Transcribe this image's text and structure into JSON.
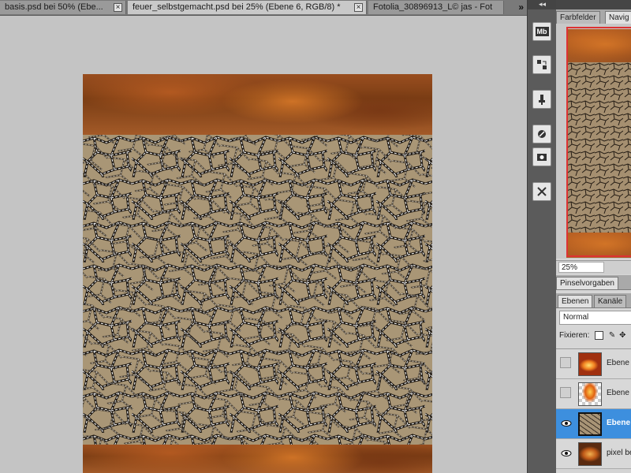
{
  "document_tabs": [
    {
      "label": "basis.psd bei 50% (Ebe...",
      "active": false
    },
    {
      "label": "feuer_selbstgemacht.psd bei 25% (Ebene 6, RGB/8) *",
      "active": true
    },
    {
      "label": "Fotolia_30896913_L© jas - Fot",
      "active": false
    }
  ],
  "tabs_overflow": "»",
  "close_glyph": "×",
  "strip": {
    "collapse_glyph": "◂◂",
    "buttons": [
      "mini-bridge-icon",
      "history-icon",
      "clone-source-icon",
      "brush-icon",
      "camera-icon",
      "tools-icon"
    ],
    "mb_label": "Mb"
  },
  "panels": {
    "top_tabs": [
      {
        "label": "Farbfelder",
        "active": false
      },
      {
        "label": "Navig",
        "active": true
      }
    ],
    "zoom": "25%",
    "brush_tab": "Pinselvorgaben",
    "layer_tabs": [
      {
        "label": "Ebenen",
        "active": true
      },
      {
        "label": "Kanäle",
        "active": false
      }
    ],
    "blend_mode": "Normal",
    "lock_label": "Fixieren:",
    "layers": [
      {
        "name": "Ebene",
        "visible": false,
        "selected": false,
        "thumb": "fire"
      },
      {
        "name": "Ebene",
        "visible": false,
        "selected": false,
        "thumb": "fire-transparent"
      },
      {
        "name": "Ebene",
        "visible": true,
        "selected": true,
        "thumb": "mud"
      },
      {
        "name": "pixel be",
        "visible": true,
        "selected": false,
        "thumb": "fire-glow"
      }
    ]
  },
  "colors": {
    "selection_blue": "#3d8fde",
    "navigator_frame": "#dd3333",
    "fire_brown": "#7a3d14",
    "mud_tan": "#a89476"
  }
}
